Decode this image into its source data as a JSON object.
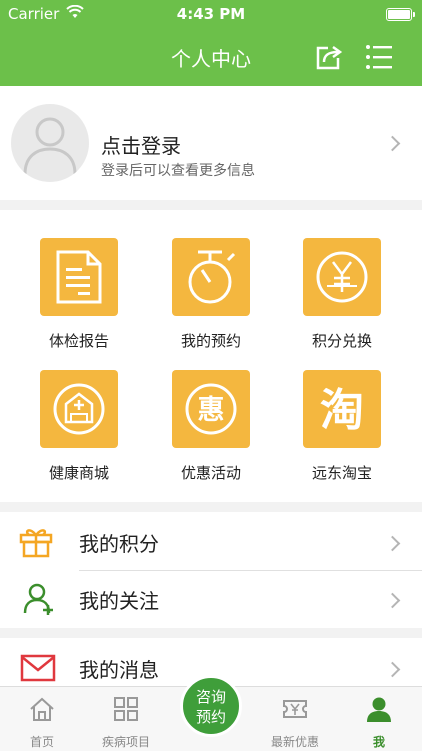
{
  "status_bar": {
    "carrier": "Carrier",
    "time": "4:43 PM"
  },
  "nav": {
    "title": "个人中心"
  },
  "profile": {
    "login": "点击登录",
    "hint": "登录后可以查看更多信息"
  },
  "grid": [
    {
      "label": "体检报告",
      "icon": "document-icon"
    },
    {
      "label": "我的预约",
      "icon": "timer-icon"
    },
    {
      "label": "积分兑换",
      "icon": "yuan-exchange-icon"
    },
    {
      "label": "健康商城",
      "icon": "store-icon"
    },
    {
      "label": "优惠活动",
      "icon": "discount-icon"
    },
    {
      "label": "远东淘宝",
      "icon": "taobao-icon"
    }
  ],
  "list": [
    {
      "label": "我的积分",
      "icon": "gift-icon"
    },
    {
      "label": "我的关注",
      "icon": "user-add-icon"
    },
    {
      "label": "我的消息",
      "icon": "mail-icon"
    }
  ],
  "tabbar": {
    "home": "首页",
    "disease": "疾病项目",
    "consult": "咨询预约",
    "deals": "最新优惠",
    "me": "我"
  },
  "grid_glyphs": {
    "discount": "惠",
    "taobao": "淘"
  },
  "colors": {
    "primary": "#6cc04a",
    "tile": "#f4b73f",
    "active": "#3b8e2c"
  }
}
